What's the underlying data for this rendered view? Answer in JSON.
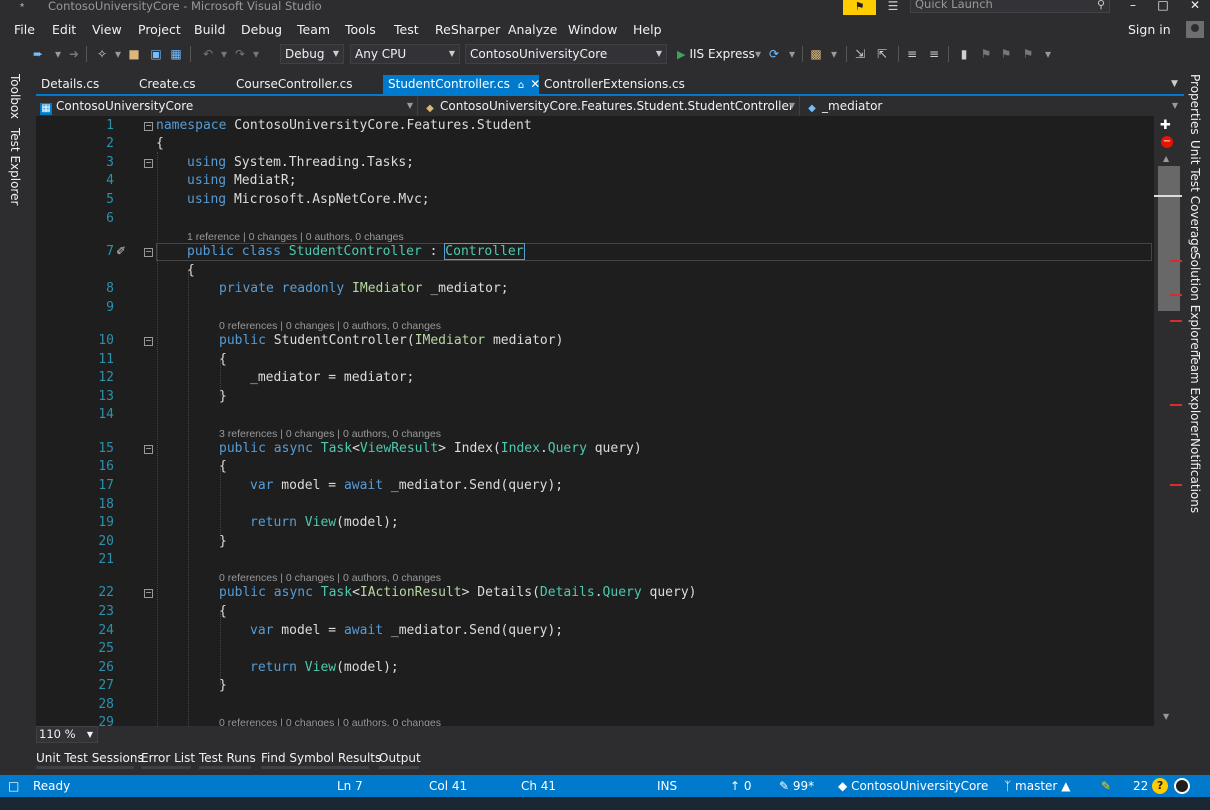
{
  "window": {
    "title": "ContosoUniversityCore - Microsoft Visual Studio",
    "quick_launch_placeholder": "Quick Launch"
  },
  "menu": [
    "File",
    "Edit",
    "View",
    "Project",
    "Build",
    "Debug",
    "Team",
    "Tools",
    "Test",
    "ReSharper",
    "Analyze",
    "Window",
    "Help"
  ],
  "account": {
    "signin_label": "Sign in"
  },
  "toolbar": {
    "configuration": "Debug",
    "platform": "Any CPU",
    "startup_project": "ContosoUniversityCore",
    "run_label": "IIS Express"
  },
  "side_tabs": {
    "left": [
      "Toolbox",
      "Test Explorer"
    ],
    "right": [
      "Properties",
      "Unit Test Coverage",
      "Solution Explorer",
      "Team Explorer",
      "Notifications"
    ]
  },
  "doc_tabs": [
    {
      "label": "Details.cs",
      "active": false
    },
    {
      "label": "Create.cs",
      "active": false
    },
    {
      "label": "CourseController.cs",
      "active": false
    },
    {
      "label": "StudentController.cs",
      "active": true
    },
    {
      "label": "ControllerExtensions.cs",
      "active": false
    }
  ],
  "navbar": {
    "project": "ContosoUniversityCore",
    "type": "ContosoUniversityCore.Features.Student.StudentController",
    "member": "_mediator"
  },
  "editor": {
    "lines": [
      {
        "n": "1"
      },
      {
        "n": "2"
      },
      {
        "n": "3"
      },
      {
        "n": "4"
      },
      {
        "n": "5"
      },
      {
        "n": "6"
      },
      {
        "n": "7"
      },
      {
        "n": "8"
      },
      {
        "n": "9"
      },
      {
        "n": "10"
      },
      {
        "n": "11"
      },
      {
        "n": "12"
      },
      {
        "n": "13"
      },
      {
        "n": "14"
      },
      {
        "n": "15"
      },
      {
        "n": "16"
      },
      {
        "n": "17"
      },
      {
        "n": "18"
      },
      {
        "n": "19"
      },
      {
        "n": "20"
      },
      {
        "n": "21"
      },
      {
        "n": "22"
      },
      {
        "n": "23"
      },
      {
        "n": "24"
      },
      {
        "n": "25"
      },
      {
        "n": "26"
      },
      {
        "n": "27"
      },
      {
        "n": "28"
      },
      {
        "n": "29"
      }
    ],
    "code": {
      "l1_kw": "namespace",
      "l1_ns": " ContosoUniversityCore.Features.Student",
      "l2": "{",
      "l3_kw": "using",
      "l3_ns": " System.Threading.Tasks;",
      "l4_kw": "using",
      "l4_ns": " MediatR;",
      "l5_kw": "using",
      "l5_ns": " Microsoft.AspNetCore.Mvc;",
      "l7_kw": "public class",
      "l7_name": " StudentController",
      "l7_colon": " : ",
      "l7_base": "Controller",
      "l8": "{",
      "l9_kw": "private readonly",
      "l9_type": " IMediator",
      "l9_rest": " _mediator;",
      "l11_kw": "public",
      "l11_name": " StudentController(",
      "l11_type": "IMediator",
      "l11_rest": " mediator)",
      "l12": "{",
      "l13": "_mediator = mediator;",
      "l14": "}",
      "l16_kw": "public async",
      "l16_t1": " Task",
      "l16_lt": "<",
      "l16_t2": "ViewResult",
      "l16_gt": ">",
      "l16_name": " Index(",
      "l16_t3": "Index",
      "l16_dot": ".",
      "l16_t4": "Query",
      "l16_rest": " query)",
      "l17": "{",
      "l18_kw": "var",
      "l18_a": " model = ",
      "l18_await": "await",
      "l18_rest": " _mediator.Send(query);",
      "l20_kw": "return",
      "l20_view": " View",
      "l20_rest": "(model);",
      "l21": "}",
      "l23_kw": "public async",
      "l23_t1": " Task",
      "l23_lt": "<",
      "l23_t2": "IActionResult",
      "l23_gt": ">",
      "l23_name": " Details(",
      "l23_t3": "Details",
      "l23_dot": ".",
      "l23_t4": "Query",
      "l23_rest": " query)",
      "l24": "{",
      "l25_kw": "var",
      "l25_a": " model = ",
      "l25_await": "await",
      "l25_rest": " _mediator.Send(query);",
      "l27_kw": "return",
      "l27_view": " View",
      "l27_rest": "(model);",
      "l28": "}"
    },
    "lens": {
      "class": "1 reference | 0 changes | 0 authors, 0 changes",
      "ctor": "0 references | 0 changes | 0 authors, 0 changes",
      "index": "3 references | 0 changes | 0 authors, 0 changes",
      "details": "0 references | 0 changes | 0 authors, 0 changes",
      "next": "0 references | 0 changes | 0 authors, 0 changes"
    },
    "zoom": "110 %"
  },
  "bottom_tabs": [
    "Unit Test Sessions",
    "Error List",
    "Test Runs",
    "Find Symbol Results",
    "Output"
  ],
  "status": {
    "state": "Ready",
    "ln": "Ln 7",
    "col": "Col 41",
    "ch": "Ch 41",
    "mode": "INS",
    "push": "0",
    "pending": "99*",
    "repo": "ContosoUniversityCore",
    "branch": "master",
    "notifications": "22"
  },
  "colors": {
    "accent": "#007acc",
    "editor_bg": "#1e1e1e",
    "chrome_bg": "#2d2d30",
    "keyword": "#569cd6",
    "type": "#4ec9b0",
    "interface": "#b8d7a3",
    "line_number": "#2b91af",
    "feedback": "#ffcc00"
  },
  "icons": [
    "vs-logo-icon",
    "feedback-icon",
    "filter-icon",
    "search-icon",
    "minimize-icon",
    "maximize-icon",
    "close-icon",
    "account-icon",
    "play-icon",
    "refresh-icon",
    "bookmark-icon",
    "brush-icon",
    "split-icon",
    "error-icon",
    "up-arrow-icon",
    "pencil-icon",
    "git-icon",
    "branch-icon",
    "bell-icon"
  ]
}
